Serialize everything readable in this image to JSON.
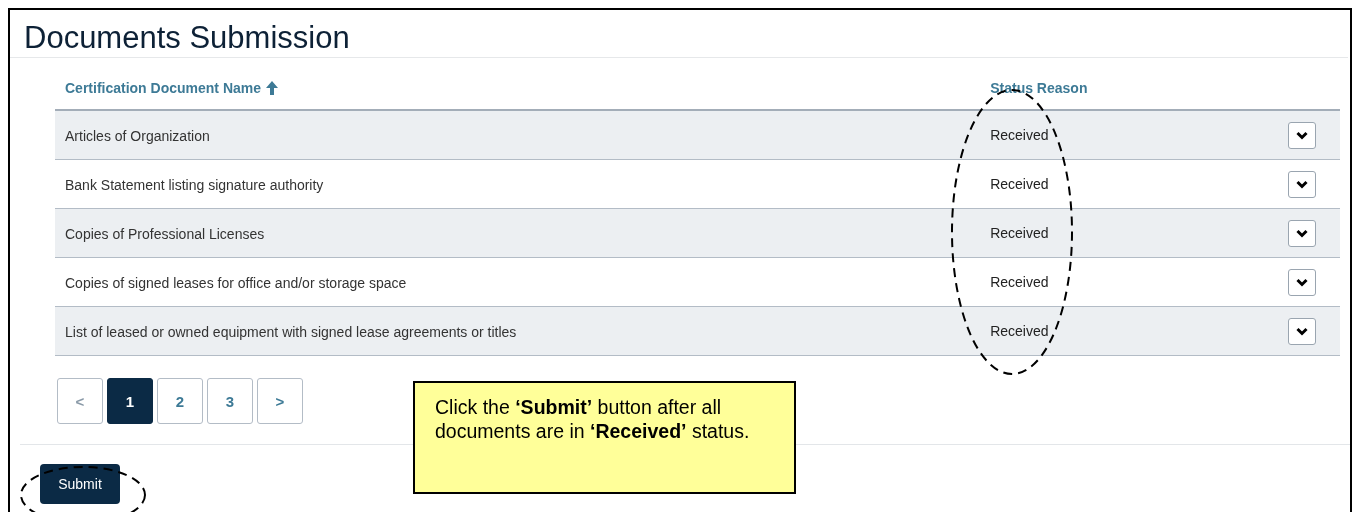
{
  "title": "Documents Submission",
  "table": {
    "columns": [
      {
        "label": "Certification Document Name",
        "sorted": true
      },
      {
        "label": "Status Reason"
      }
    ],
    "rows": [
      {
        "name": "Articles of Organization",
        "status": "Received"
      },
      {
        "name": "Bank Statement listing signature authority",
        "status": "Received"
      },
      {
        "name": "Copies of Professional Licenses",
        "status": "Received"
      },
      {
        "name": "Copies of signed leases for office and/or storage space",
        "status": "Received"
      },
      {
        "name": "List of leased or owned equipment with signed lease agreements or titles",
        "status": "Received"
      }
    ]
  },
  "pagination": {
    "prev": "<",
    "next": ">",
    "pages": [
      {
        "label": "1",
        "selected": true
      },
      {
        "label": "2",
        "selected": false
      },
      {
        "label": "3",
        "selected": false
      }
    ]
  },
  "submit_button": "Submit",
  "callout": "Click the **‘Submit’** button after all documents are in **‘Received’** status."
}
